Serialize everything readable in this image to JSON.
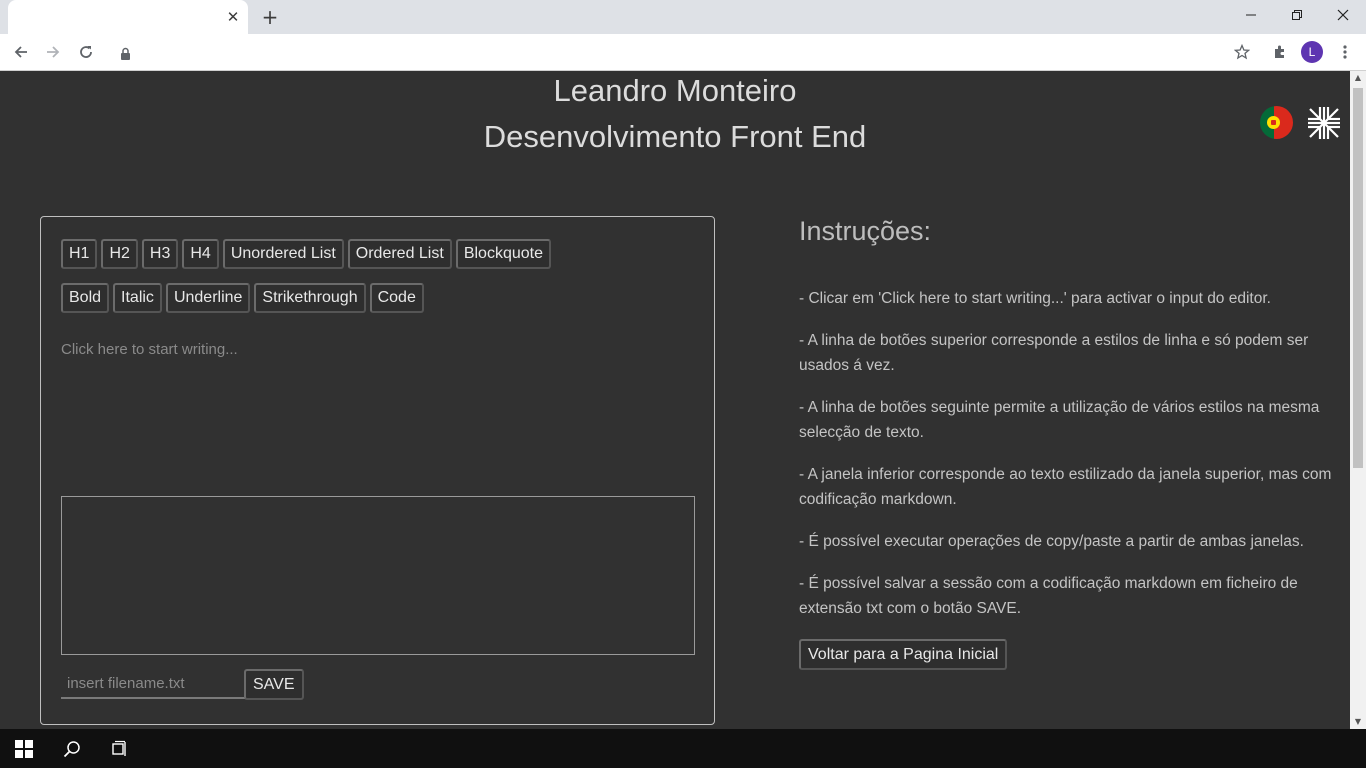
{
  "browser": {
    "tab_close_glyph": "✕",
    "new_tab_glyph": "+",
    "avatar_letter": "L",
    "window_controls": [
      "minimize-icon",
      "restore-icon",
      "close-icon"
    ]
  },
  "header": {
    "name": "Leandro Monteiro",
    "role": "Desenvolvimento Front End",
    "languages": [
      "portugal-flag-icon",
      "uk-flag-icon"
    ]
  },
  "editor": {
    "block_buttons": [
      "H1",
      "H2",
      "H3",
      "H4",
      "Unordered List",
      "Ordered List",
      "Blockquote"
    ],
    "inline_buttons": [
      "Bold",
      "Italic",
      "Underline",
      "Strikethrough",
      "Code"
    ],
    "placeholder": "Click here to start writing...",
    "markdown_output": "",
    "filename_placeholder": "insert filename.txt",
    "save_label": "SAVE"
  },
  "instructions": {
    "title": "Instruções:",
    "items": [
      "- Clicar em 'Click here to start writing...' para activar o input do editor.",
      "- A linha de botões superior corresponde a estilos de linha e só podem ser usados á vez.",
      "- A linha de botões seguinte permite a utilização de vários estilos na mesma selecção de texto.",
      "- A janela inferior corresponde ao texto estilizado da janela superior, mas com codificação markdown.",
      "- É possível executar operações de copy/paste a partir de ambas janelas.",
      "- É possível salvar a sessão com a codificação markdown em ficheiro de extensão txt com o botão SAVE."
    ],
    "back_label": "Voltar para a Pagina Inicial"
  },
  "colors": {
    "page_bg": "#313131",
    "text": "#dcdcdc",
    "muted": "#8a8a8a"
  }
}
